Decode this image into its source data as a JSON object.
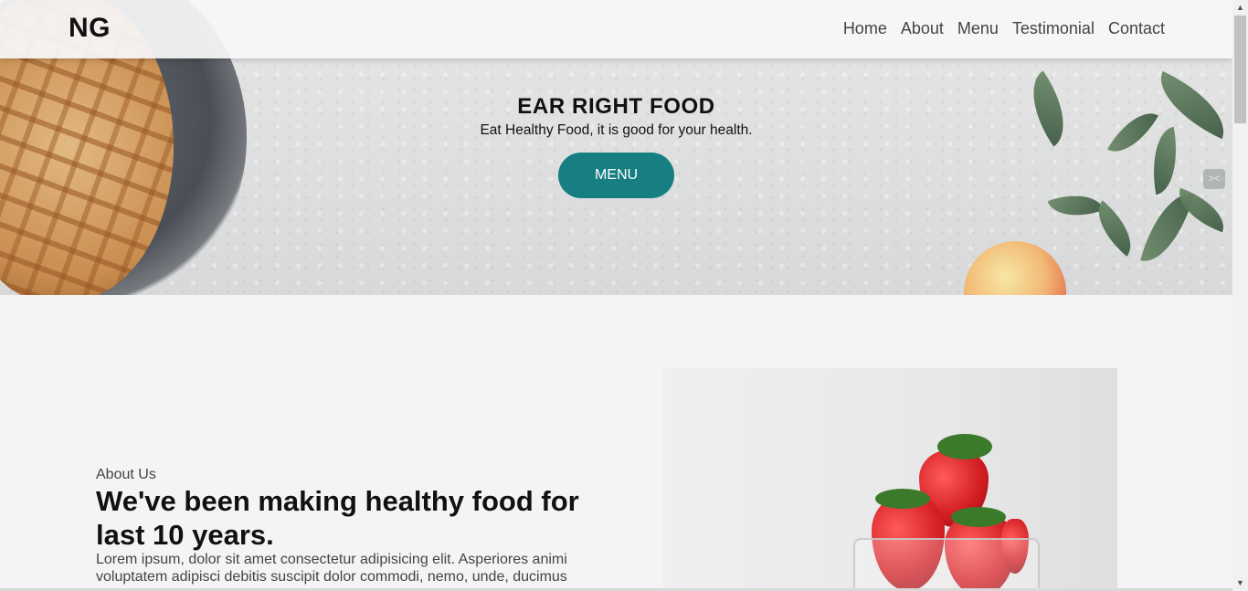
{
  "header": {
    "logo": "NG",
    "nav": [
      "Home",
      "About",
      "Menu",
      "Testimonial",
      "Contact"
    ]
  },
  "hero": {
    "title": "EAR RIGHT FOOD",
    "subtitle": "Eat Healthy Food, it is good for your health.",
    "button_label": "MENU",
    "button_color": "#177f82"
  },
  "about": {
    "label": "About Us",
    "heading": "We've been making healthy food for last 10 years.",
    "body": "Lorem ipsum, dolor sit amet consectetur adipisicing elit. Asperiores animi voluptatem adipisci debitis suscipit dolor commodi, nemo, unde, ducimus"
  },
  "icons": {
    "side_handle": "collapse-arrows-icon",
    "scroll_up": "scroll-up-arrow-icon",
    "scroll_down": "scroll-down-arrow-icon"
  }
}
